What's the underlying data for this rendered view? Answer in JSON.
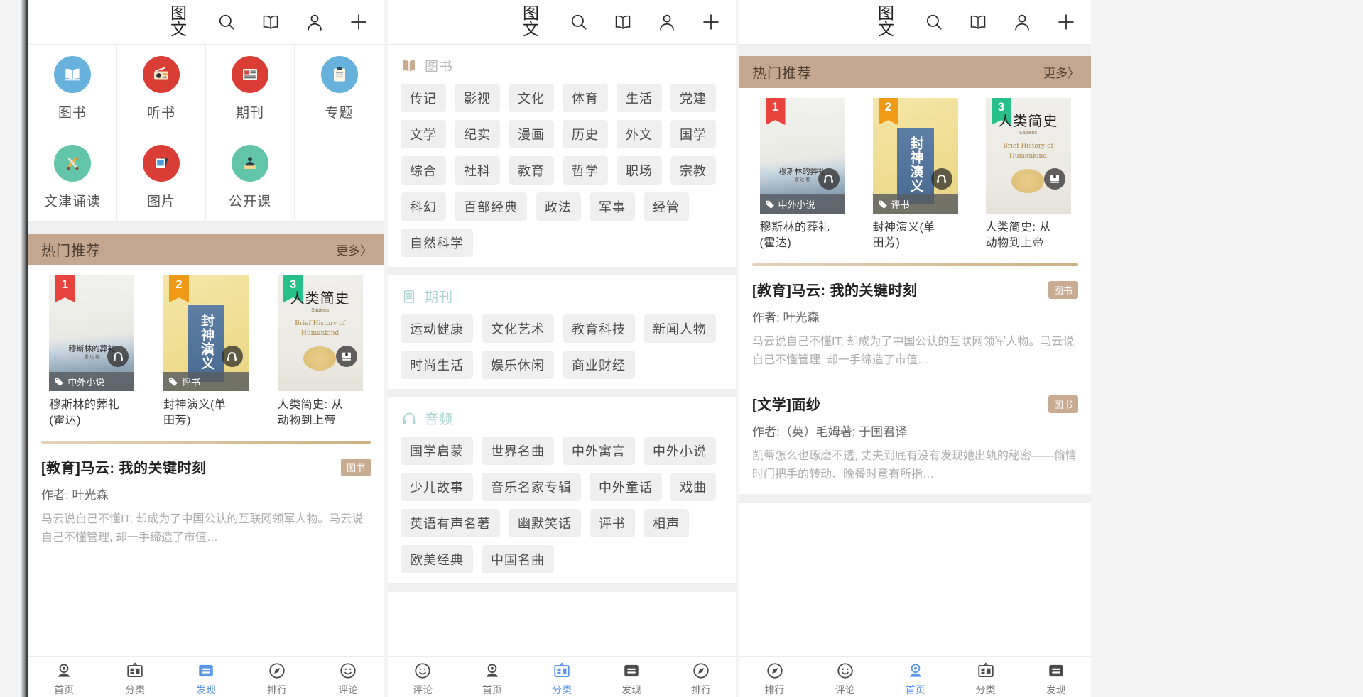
{
  "topbar": {
    "icons": [
      {
        "name": "text-image-toggle-icon",
        "glyph": "图文"
      },
      {
        "name": "search-icon",
        "glyph": "search"
      },
      {
        "name": "book-icon",
        "glyph": "book"
      },
      {
        "name": "user-icon",
        "glyph": "user"
      },
      {
        "name": "add-icon",
        "glyph": "plus"
      }
    ]
  },
  "entry_grid": {
    "items": [
      {
        "label": "图书",
        "icon": "open-book-icon",
        "bg": "#66b2dd",
        "glyph": "📖"
      },
      {
        "label": "听书",
        "icon": "radio-icon",
        "bg": "#d93d34",
        "glyph": "📻"
      },
      {
        "label": "期刊",
        "icon": "newspaper-icon",
        "bg": "#d93d34",
        "glyph": "📰"
      },
      {
        "label": "专题",
        "icon": "clipboard-icon",
        "bg": "#66b2dd",
        "glyph": "📋"
      },
      {
        "label": "文津诵读",
        "icon": "brush-pencil-icon",
        "bg": "#62c4a8",
        "glyph": "✏"
      },
      {
        "label": "图片",
        "icon": "photos-icon",
        "bg": "#d93d34",
        "glyph": "🖼"
      },
      {
        "label": "公开课",
        "icon": "lecturer-icon",
        "bg": "#62c4a8",
        "glyph": "👤"
      }
    ]
  },
  "hot": {
    "title": "热门推荐",
    "more_label": "更多〉",
    "books": [
      {
        "rank": "1",
        "tag": "中外小说",
        "cover_title": "穆斯林的葬礼",
        "cover_sub": "霍 达 著",
        "caption": "穆斯林的葬礼\n(霍达)",
        "badge": "headphones-badge"
      },
      {
        "rank": "2",
        "tag": "评书",
        "cover_title": "封神演义",
        "cover_sub": "",
        "caption": "封神演义(单\n田芳)",
        "badge": "headphones-badge"
      },
      {
        "rank": "3",
        "tag": "",
        "cover_title": "人类简史",
        "cover_sub": "Sapiens",
        "cover_sub2": "Brief History of\nHumankind",
        "caption": "人类简史: 从\n动物到上帝",
        "badge": "book-badge"
      }
    ]
  },
  "articles": [
    {
      "title": "[教育]马云: 我的关键时刻",
      "tag": "图书",
      "author": "作者: 叶光森",
      "desc": "马云说自己不懂IT, 却成为了中国公认的互联网领军人物。马云说自己不懂管理, 却一手缔造了市值…"
    },
    {
      "title": "[文学]面纱",
      "tag": "图书",
      "author": "作者:（英）毛姆著; 于国君译",
      "desc": "凯蒂怎么也琢磨不透, 丈夫到底有没有发现她出轨的秘密——偷情时门把手的转动、晚餐时意有所指…"
    }
  ],
  "tag_sections": [
    {
      "label": "图书",
      "icon": "open-book-icon",
      "color_class": "lb-book",
      "chips": [
        "传记",
        "影视",
        "文化",
        "体育",
        "生活",
        "党建",
        "文学",
        "纪实",
        "漫画",
        "历史",
        "外文",
        "国学",
        "综合",
        "社科",
        "教育",
        "哲学",
        "职场",
        "宗教",
        "科幻",
        "百部经典",
        "政法",
        "军事",
        "经管",
        "自然科学"
      ]
    },
    {
      "label": "期刊",
      "icon": "scroll-icon",
      "color_class": "lb-mag",
      "chips": [
        "运动健康",
        "文化艺术",
        "教育科技",
        "新闻人物",
        "时尚生活",
        "娱乐休闲",
        "商业财经"
      ]
    },
    {
      "label": "音频",
      "icon": "headphones-icon",
      "color_class": "lb-aud",
      "chips": [
        "国学启蒙",
        "世界名曲",
        "中外寓言",
        "中外小说",
        "少儿故事",
        "音乐名家专辑",
        "中外童话",
        "戏曲",
        "英语有声名著",
        "幽默笑话",
        "评书",
        "相声",
        "欧美经典",
        "中国名曲"
      ]
    }
  ],
  "bottom_nav": {
    "items": [
      {
        "label": "首页",
        "icon": "home-user-icon"
      },
      {
        "label": "分类",
        "icon": "category-board-icon"
      },
      {
        "label": "发现",
        "icon": "discover-list-icon"
      },
      {
        "label": "排行",
        "icon": "rank-compass-icon"
      },
      {
        "label": "评论",
        "icon": "comment-smiley-icon"
      }
    ],
    "active_panel_1": 2,
    "active_panel_2": 1,
    "active_panel_3": 0
  },
  "colors": {
    "accent_blue": "#5b96e8",
    "hot_band": "#c5a78f",
    "tag_badge": "#c9ab92",
    "chip_bg": "#efefef"
  }
}
